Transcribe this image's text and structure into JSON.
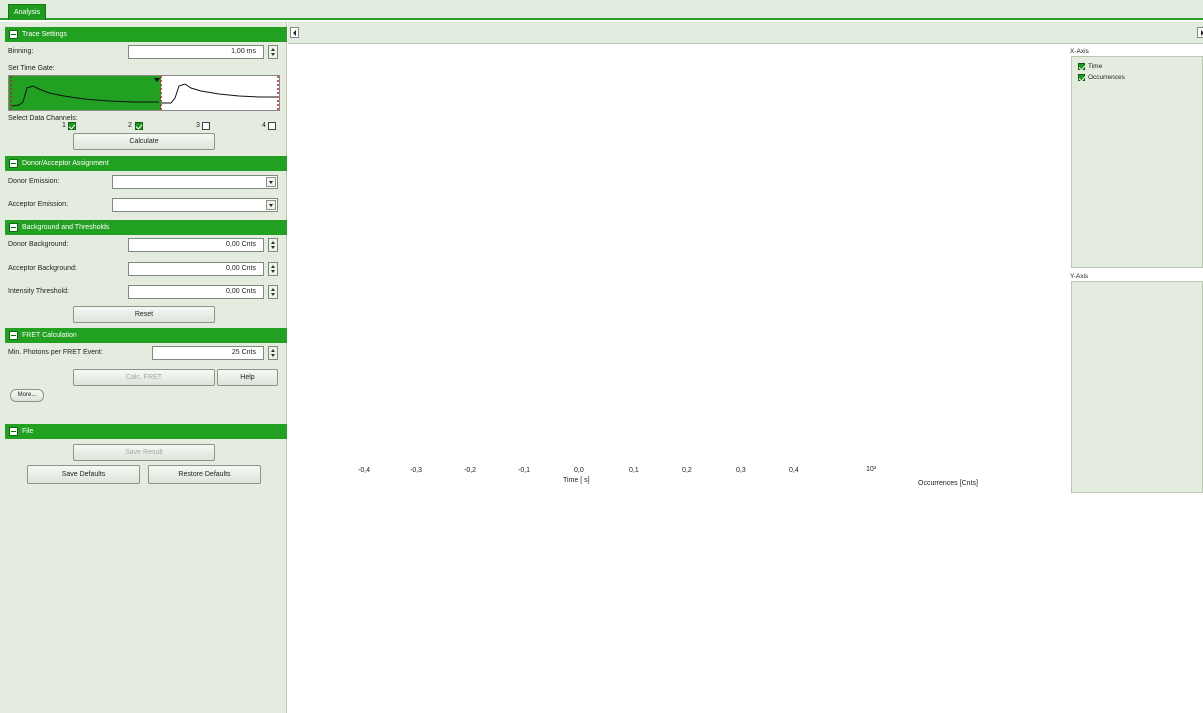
{
  "tabs": [
    {
      "label": "Analysis"
    }
  ],
  "sections": {
    "trace": {
      "title": "Trace Settings",
      "binning_label": "Binning:",
      "binning_value": "1,00 ms",
      "time_gate_label": "Set Time Gate:",
      "channels_label": "Select Data Channels:",
      "channels": [
        {
          "num": "1",
          "checked": true
        },
        {
          "num": "2",
          "checked": true
        },
        {
          "num": "3",
          "checked": false
        },
        {
          "num": "4",
          "checked": false
        }
      ],
      "calculate_label": "Calculate"
    },
    "assignment": {
      "title": "Donor/Acceptor Assignment",
      "donor_label": "Donor Emission:",
      "donor_value": "",
      "acceptor_label": "Acceptor Emission:",
      "acceptor_value": ""
    },
    "background": {
      "title": "Background and Thresholds",
      "donor_bg_label": "Donor Background:",
      "donor_bg_value": "0,00 Cnts",
      "acceptor_bg_label": "Acceptor Background:",
      "acceptor_bg_value": "0,00 Cnts",
      "threshold_label": "Intensity Threshold:",
      "threshold_value": "0,00 Cnts",
      "reset_label": "Reset"
    },
    "fret": {
      "title": "FRET Calculation",
      "min_photons_label": "Min. Photons per FRET Event:",
      "min_photons_value": "25 Cnts",
      "calc_label": "Calc. FRET",
      "help_label": "Help",
      "more_label": "More..."
    },
    "file": {
      "title": "File",
      "save_result_label": "Save Result",
      "save_defaults_label": "Save Defaults",
      "restore_defaults_label": "Restore Defaults"
    }
  },
  "plot": {
    "x_ticks": [
      "-0,4",
      "-0,3",
      "-0,2",
      "-0,1",
      "0,0",
      "0,1",
      "0,2",
      "0,3",
      "0,4"
    ],
    "x_label": "Time [ s]",
    "y_tick": "10³",
    "y_label": "Occurrences [Cnts]"
  },
  "axes_panel": {
    "x_title": "X-Axis",
    "x_items": [
      {
        "label": "Time",
        "checked": true
      },
      {
        "label": "Occurrences",
        "checked": true
      }
    ],
    "y_title": "Y-Axis"
  },
  "colors": {
    "accent": "#22a022",
    "panel": "#e4ecdf"
  }
}
